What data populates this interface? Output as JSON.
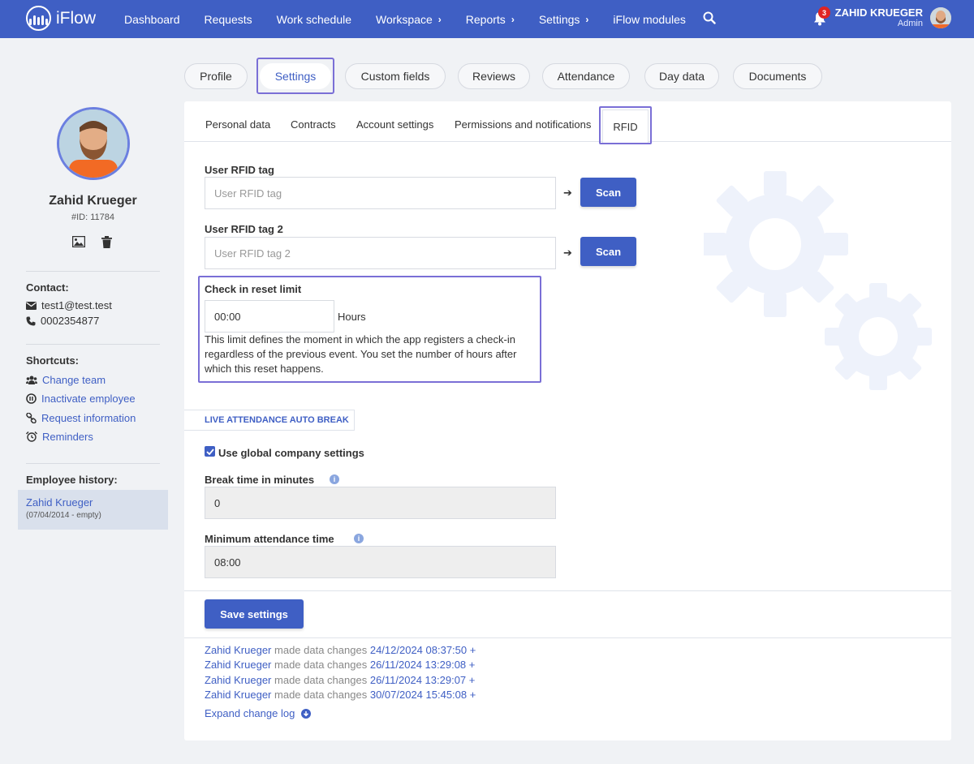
{
  "app": {
    "name": "iFlow"
  },
  "nav": {
    "items": [
      {
        "label": "Dashboard",
        "chevron": ""
      },
      {
        "label": "Requests",
        "chevron": ""
      },
      {
        "label": "Work schedule",
        "chevron": ""
      },
      {
        "label": "Workspace",
        "chevron": "›"
      },
      {
        "label": "Reports",
        "chevron": "›"
      },
      {
        "label": "Settings",
        "chevron": "›"
      },
      {
        "label": "iFlow modules",
        "chevron": ""
      }
    ],
    "notification_count": "3",
    "user_name": "ZAHID KRUEGER",
    "user_role": "Admin"
  },
  "top_tabs": [
    "Profile",
    "Settings",
    "Custom fields",
    "Reviews",
    "Attendance",
    "Day data",
    "Documents"
  ],
  "sidebar": {
    "name": "Zahid Krueger",
    "id": "#ID: 11784",
    "contact_heading": "Contact:",
    "email": "test1@test.test",
    "phone": "0002354877",
    "shortcuts_heading": "Shortcuts:",
    "shortcuts": [
      "Change team",
      "Inactivate employee",
      "Request information",
      "Reminders"
    ],
    "history_heading": "Employee history:",
    "history_name": "Zahid Krueger",
    "history_date": "(07/04/2014 - empty)"
  },
  "sub_tabs": [
    "Personal data",
    "Contracts",
    "Account settings",
    "Permissions and notifications",
    "RFID"
  ],
  "form": {
    "rfid1_label": "User RFID tag",
    "rfid1_placeholder": "User RFID tag",
    "rfid2_label": "User RFID tag 2",
    "rfid2_placeholder": "User RFID tag 2",
    "arrow": "➔",
    "scan_label": "Scan",
    "reset_label": "Check in reset limit",
    "reset_value": "00:00",
    "reset_unit": "Hours",
    "reset_hint": "This limit defines the moment in which the app registers a check-in regardless of the previous event. You set the number of hours after which this reset happens.",
    "section_title": "LIVE ATTENDANCE AUTO BREAK",
    "global_label": "Use global company settings",
    "break_label": "Break time in minutes",
    "break_value": "0",
    "min_label": "Minimum attendance time",
    "min_value": "08:00",
    "save_label": "Save settings"
  },
  "log": {
    "entries": [
      {
        "who": "Zahid Krueger",
        "what": "made data changes",
        "when": "24/12/2024 08:37:50 +"
      },
      {
        "who": "Zahid Krueger",
        "what": "made data changes",
        "when": "26/11/2024 13:29:08 +"
      },
      {
        "who": "Zahid Krueger",
        "what": "made data changes",
        "when": "26/11/2024 13:29:07 +"
      },
      {
        "who": "Zahid Krueger",
        "what": "made data changes",
        "when": "30/07/2024 15:45:08 +"
      }
    ],
    "expand_label": "Expand change log"
  },
  "colors": {
    "primary": "#3f5fc4",
    "highlight": "#7a6fd6"
  }
}
